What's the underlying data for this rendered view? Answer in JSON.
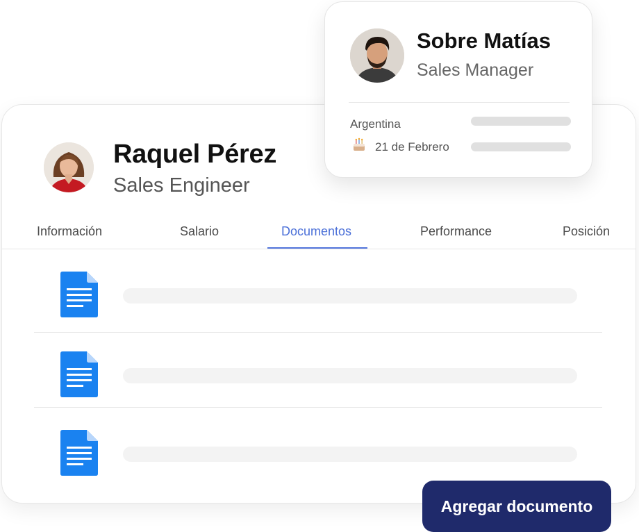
{
  "profile": {
    "name": "Raquel Pérez",
    "role": "Sales Engineer"
  },
  "tabs": [
    {
      "label": "Información",
      "active": false
    },
    {
      "label": "Salario",
      "active": false
    },
    {
      "label": "Documentos",
      "active": true
    },
    {
      "label": "Performance",
      "active": false
    },
    {
      "label": "Posición",
      "active": false
    }
  ],
  "documents": [
    {
      "icon": "document-icon"
    },
    {
      "icon": "document-icon"
    },
    {
      "icon": "document-icon"
    }
  ],
  "popup": {
    "title": "Sobre Matías",
    "subtitle": "Sales Manager",
    "country": "Argentina",
    "birthday": "21 de Febrero",
    "birthday_icon": "cake-icon"
  },
  "actions": {
    "add_document_label": "Agregar documento"
  },
  "colors": {
    "accent": "#4a6fd8",
    "button": "#1f2a6b",
    "doc_icon": "#1a82f0"
  }
}
